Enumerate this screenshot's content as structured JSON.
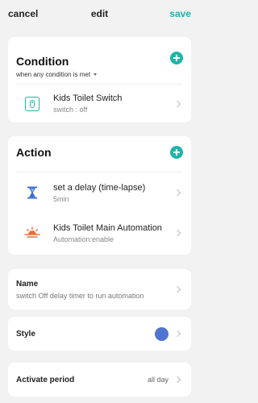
{
  "topbar": {
    "cancel": "cancel",
    "title": "edit",
    "save": "save"
  },
  "condition": {
    "title": "Condition",
    "subtitle": "when any condition is met",
    "items": [
      {
        "name": "Kids Toilet Switch",
        "detail": "switch : off",
        "icon": "switch-icon"
      }
    ]
  },
  "action": {
    "title": "Action",
    "items": [
      {
        "name": "set a delay (time-lapse)",
        "detail": "5min",
        "icon": "hourglass-icon"
      },
      {
        "name": "Kids Toilet Main Automation",
        "detail": "Automation:enable",
        "icon": "sunrise-icon"
      }
    ]
  },
  "name_field": {
    "label": "Name",
    "value": "switch Off delay timer to run automation"
  },
  "style": {
    "label": "Style",
    "color": "#4f74d2"
  },
  "period": {
    "label": "Activate period",
    "value": "all day"
  },
  "colors": {
    "accent": "#1fb5a8",
    "style_dot": "#4f74d2",
    "sunrise": "#e8703a",
    "hourglass": "#3b6fd6"
  }
}
